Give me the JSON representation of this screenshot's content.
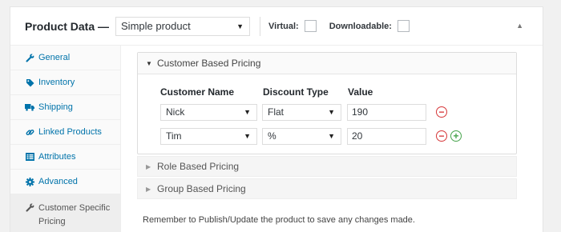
{
  "header": {
    "title": "Product Data —",
    "product_type": "Simple product",
    "virtual_label": "Virtual:",
    "downloadable_label": "Downloadable:",
    "collapse_icon": "triangle-up-icon"
  },
  "sidebar": {
    "items": [
      {
        "label": "General",
        "icon": "wrench-icon"
      },
      {
        "label": "Inventory",
        "icon": "tag-icon"
      },
      {
        "label": "Shipping",
        "icon": "truck-icon"
      },
      {
        "label": "Linked Products",
        "icon": "link-icon"
      },
      {
        "label": "Attributes",
        "icon": "list-icon"
      },
      {
        "label": "Advanced",
        "icon": "gear-icon"
      },
      {
        "label": "Customer Specific Pricing",
        "icon": "wrench-icon",
        "active": true
      }
    ]
  },
  "pricing": {
    "customer": {
      "title": "Customer Based Pricing",
      "columns": {
        "customer": "Customer Name",
        "discount": "Discount Type",
        "value": "Value"
      },
      "rows": [
        {
          "customer": "Nick",
          "discount": "Flat",
          "value": "190"
        },
        {
          "customer": "Tim",
          "discount": "%",
          "value": "20"
        }
      ]
    },
    "role": {
      "title": "Role Based Pricing"
    },
    "group": {
      "title": "Group Based Pricing"
    }
  },
  "notice": "Remember to Publish/Update the product to save any changes made.",
  "colors": {
    "link": "#0073aa",
    "remove": "#d63638",
    "add": "#46a34b"
  }
}
